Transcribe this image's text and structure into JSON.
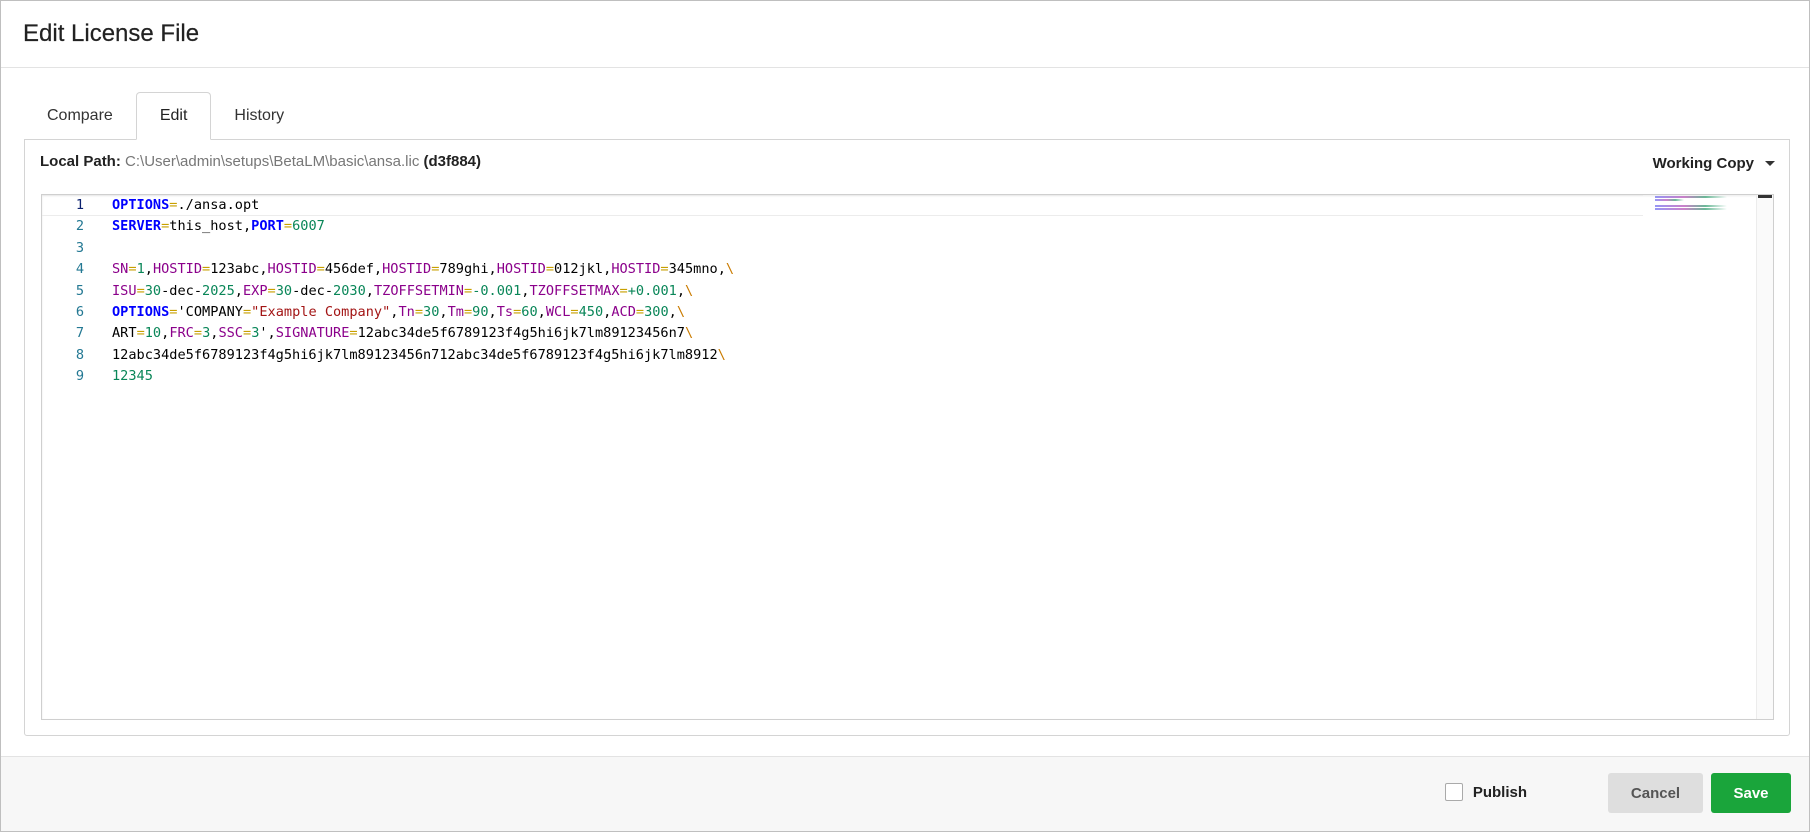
{
  "dialog": {
    "title": "Edit License File"
  },
  "tabs": [
    {
      "label": "Compare"
    },
    {
      "label": "Edit"
    },
    {
      "label": "History"
    }
  ],
  "path": {
    "label": "Local Path:",
    "value": "C:\\User\\admin\\setups\\BetaLM\\basic\\ansa.lic",
    "hash": "(d3f884)"
  },
  "version": {
    "selected": "Working Copy"
  },
  "editor": {
    "lines": [
      [
        [
          "kw",
          "OPTIONS"
        ],
        [
          "op",
          "="
        ],
        [
          "tx",
          "./ansa.opt"
        ]
      ],
      [
        [
          "kw",
          "SERVER"
        ],
        [
          "op",
          "="
        ],
        [
          "tx",
          "this_host,"
        ],
        [
          "kw",
          "PORT"
        ],
        [
          "op",
          "="
        ],
        [
          "num",
          "6007"
        ]
      ],
      [],
      [
        [
          "var",
          "SN"
        ],
        [
          "op",
          "="
        ],
        [
          "num",
          "1"
        ],
        [
          "tx",
          ","
        ],
        [
          "var",
          "HOSTID"
        ],
        [
          "op",
          "="
        ],
        [
          "tx",
          "123abc,"
        ],
        [
          "var",
          "HOSTID"
        ],
        [
          "op",
          "="
        ],
        [
          "tx",
          "456def,"
        ],
        [
          "var",
          "HOSTID"
        ],
        [
          "op",
          "="
        ],
        [
          "tx",
          "789ghi,"
        ],
        [
          "var",
          "HOSTID"
        ],
        [
          "op",
          "="
        ],
        [
          "tx",
          "012jkl,"
        ],
        [
          "var",
          "HOSTID"
        ],
        [
          "op",
          "="
        ],
        [
          "tx",
          "345mno,"
        ],
        [
          "esc",
          "\\"
        ]
      ],
      [
        [
          "var",
          "ISU"
        ],
        [
          "op",
          "="
        ],
        [
          "num",
          "30"
        ],
        [
          "tx",
          "-dec-"
        ],
        [
          "num",
          "2025"
        ],
        [
          "tx",
          ","
        ],
        [
          "var",
          "EXP"
        ],
        [
          "op",
          "="
        ],
        [
          "num",
          "30"
        ],
        [
          "tx",
          "-dec-"
        ],
        [
          "num",
          "2030"
        ],
        [
          "tx",
          ","
        ],
        [
          "var",
          "TZOFFSETMIN"
        ],
        [
          "op",
          "="
        ],
        [
          "num",
          "-0.001"
        ],
        [
          "tx",
          ","
        ],
        [
          "var",
          "TZOFFSETMAX"
        ],
        [
          "op",
          "="
        ],
        [
          "num",
          "+0.001"
        ],
        [
          "tx",
          ","
        ],
        [
          "esc",
          "\\"
        ]
      ],
      [
        [
          "kw",
          "OPTIONS"
        ],
        [
          "op",
          "="
        ],
        [
          "tx",
          "'COMPANY"
        ],
        [
          "op",
          "="
        ],
        [
          "str",
          "\"Example Company\""
        ],
        [
          "tx",
          ","
        ],
        [
          "var",
          "Tn"
        ],
        [
          "op",
          "="
        ],
        [
          "num",
          "30"
        ],
        [
          "tx",
          ","
        ],
        [
          "var",
          "Tm"
        ],
        [
          "op",
          "="
        ],
        [
          "num",
          "90"
        ],
        [
          "tx",
          ","
        ],
        [
          "var",
          "Ts"
        ],
        [
          "op",
          "="
        ],
        [
          "num",
          "60"
        ],
        [
          "tx",
          ","
        ],
        [
          "var",
          "WCL"
        ],
        [
          "op",
          "="
        ],
        [
          "num",
          "450"
        ],
        [
          "tx",
          ","
        ],
        [
          "var",
          "ACD"
        ],
        [
          "op",
          "="
        ],
        [
          "num",
          "300"
        ],
        [
          "tx",
          ","
        ],
        [
          "esc",
          "\\"
        ]
      ],
      [
        [
          "tx",
          "ART"
        ],
        [
          "op",
          "="
        ],
        [
          "num",
          "10"
        ],
        [
          "tx",
          ","
        ],
        [
          "var",
          "FRC"
        ],
        [
          "op",
          "="
        ],
        [
          "num",
          "3"
        ],
        [
          "tx",
          ","
        ],
        [
          "var",
          "SSC"
        ],
        [
          "op",
          "="
        ],
        [
          "num",
          "3"
        ],
        [
          "tx",
          "',"
        ],
        [
          "var",
          "SIGNATURE"
        ],
        [
          "op",
          "="
        ],
        [
          "tx",
          "12abc34de5f6789123f4g5hi6jk7lm89123456n7"
        ],
        [
          "esc",
          "\\"
        ]
      ],
      [
        [
          "tx",
          "12abc34de5f6789123f4g5hi6jk7lm89123456n712abc34de5f6789123f4g5hi6jk7lm8912"
        ],
        [
          "esc",
          "\\"
        ]
      ],
      [
        [
          "num",
          "12345"
        ]
      ]
    ]
  },
  "footer": {
    "publish_label": "Publish",
    "cancel_label": "Cancel",
    "save_label": "Save"
  }
}
